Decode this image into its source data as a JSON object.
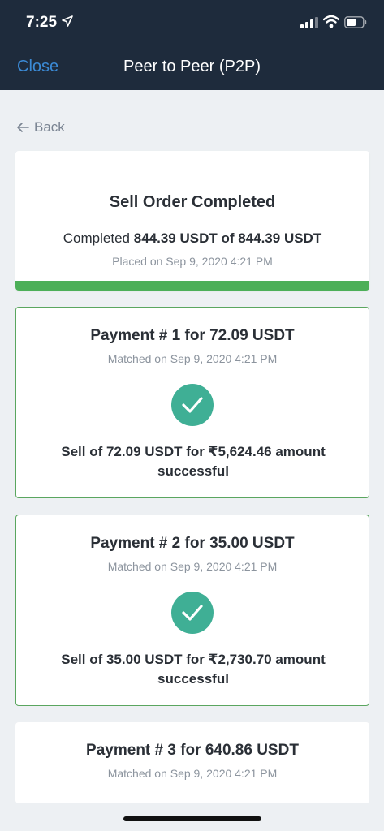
{
  "status_bar": {
    "time": "7:25"
  },
  "nav": {
    "close_label": "Close",
    "title": "Peer to Peer (P2P)"
  },
  "back": {
    "label": "Back"
  },
  "summary": {
    "title": "Sell Order Completed",
    "completed_prefix": "Completed",
    "completed_amount": "844.39 USDT of 844.39 USDT",
    "placed": "Placed on Sep 9, 2020 4:21 PM",
    "progress": 1.0,
    "progress_color": "#4caf58"
  },
  "payments": [
    {
      "title": "Payment # 1 for 72.09 USDT",
      "matched": "Matched on Sep 9, 2020 4:21 PM",
      "result": "Sell of 72.09 USDT for ₹5,624.46 amount successful",
      "icon": "check-circle-icon"
    },
    {
      "title": "Payment # 2 for 35.00 USDT",
      "matched": "Matched on Sep 9, 2020 4:21 PM",
      "result": "Sell of 35.00 USDT for ₹2,730.70 amount successful",
      "icon": "check-circle-icon"
    },
    {
      "title": "Payment # 3 for 640.86 USDT",
      "matched": "Matched on Sep 9, 2020 4:21 PM"
    }
  ],
  "colors": {
    "header_bg": "#1e2b3c",
    "accent_link": "#3b8ad6",
    "success": "#3faf95",
    "card_border": "#5aa65f"
  }
}
